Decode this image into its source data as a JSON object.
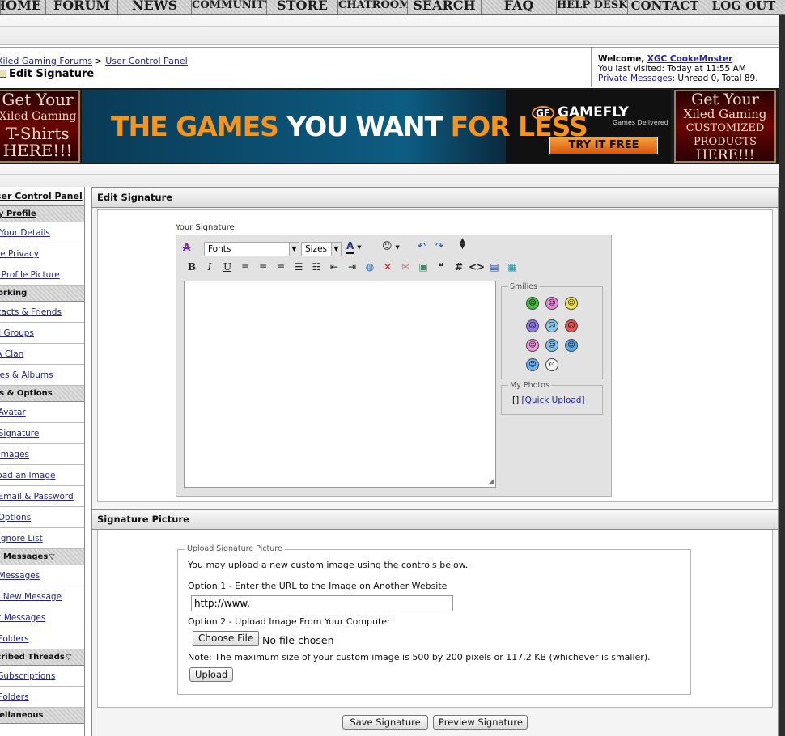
{
  "nav": {
    "items": [
      "HOME",
      "FORUM",
      "NEWS",
      "COMMUNITY",
      "STORE",
      "CHATROOM",
      "SEARCH",
      "FAQ",
      "HELP DESK",
      "CONTACT",
      "LOG OUT"
    ]
  },
  "breadcrumb": {
    "forum": "Xiled Gaming Forums",
    "sep": ">",
    "current": "User Control Panel",
    "page_title": "Edit Signature"
  },
  "welcome": {
    "greeting": "Welcome,",
    "username": "XGC CookeMnster",
    "period": ".",
    "last_visited": "You last visited: Today at 11:55 AM",
    "pm_link": "Private Messages",
    "pm_status": ": Unread 0, Total 89."
  },
  "ads": {
    "left_lines": [
      "Get Your",
      "Xiled Gaming",
      "T-Shirts",
      "HERE!!!"
    ],
    "center_slogan_1": "THE GAMES",
    "center_slogan_2": "YOU WANT",
    "center_slogan_3": "FOR LESS",
    "center_logo": "GAMEFLY",
    "center_logo_mark": "GF",
    "center_tagline": "Games Delivered",
    "center_cta": "TRY IT FREE",
    "right_lines": [
      "Get Your",
      "Xiled Gaming",
      "CUSTOMIZED",
      "PRODUCTS",
      "HERE!!!"
    ]
  },
  "sidebar": {
    "header": "User Control Panel",
    "sections": [
      {
        "title": "My Profile",
        "items": [
          "Edit Your Details",
          "Profile Privacy",
          "Edit Profile Picture"
        ]
      },
      {
        "title": "Networking",
        "items": [
          "Contacts & Friends",
          "Social Groups",
          "Join A Clan",
          "Pictures & Albums"
        ]
      },
      {
        "title": "Settings & Options",
        "items": [
          "Edit Avatar",
          "Edit Signature",
          "Edit Images",
          "Upload an Image",
          "Edit Email & Password",
          "Edit Options",
          "Edit Ignore List"
        ]
      },
      {
        "title": "Private Messages",
        "items": [
          "List Messages",
          "Send New Message",
          "Track Messages",
          "Edit Folders"
        ]
      },
      {
        "title": "Subscribed Threads",
        "items": [
          "List Subscriptions",
          "Edit Folders"
        ]
      },
      {
        "title": "Miscellaneous",
        "items": []
      }
    ]
  },
  "edit_signature": {
    "header": "Edit Signature",
    "your_signature_label": "Your Signature:",
    "fonts_select": "Fonts",
    "sizes_select": "Sizes",
    "smilies_legend": "Smilies",
    "my_photos_legend": "My Photos",
    "photos_text": "[]",
    "quick_upload": "[Quick Upload]",
    "signature_text": ""
  },
  "signature_picture": {
    "header": "Signature Picture",
    "legend": "Upload Signature Picture",
    "intro": "You may upload a new custom image using the controls below.",
    "option1": "Option 1 - Enter the URL to the Image on Another Website",
    "url_value": "http://www.",
    "option2": "Option 2 - Upload Image From Your Computer",
    "choose_file": "Choose File",
    "no_file": "No file chosen",
    "note": "Note: The maximum size of your custom image is 500 by 200 pixels or 117.2 KB (whichever is smaller).",
    "upload_button": "Upload"
  },
  "actions": {
    "save": "Save Signature",
    "preview": "Preview Signature"
  },
  "colors": {
    "link": "#22229c",
    "panel_bg": "#f4f4f4",
    "editor_bg": "#e2e2e2",
    "accent_orange": "#f7941d"
  }
}
